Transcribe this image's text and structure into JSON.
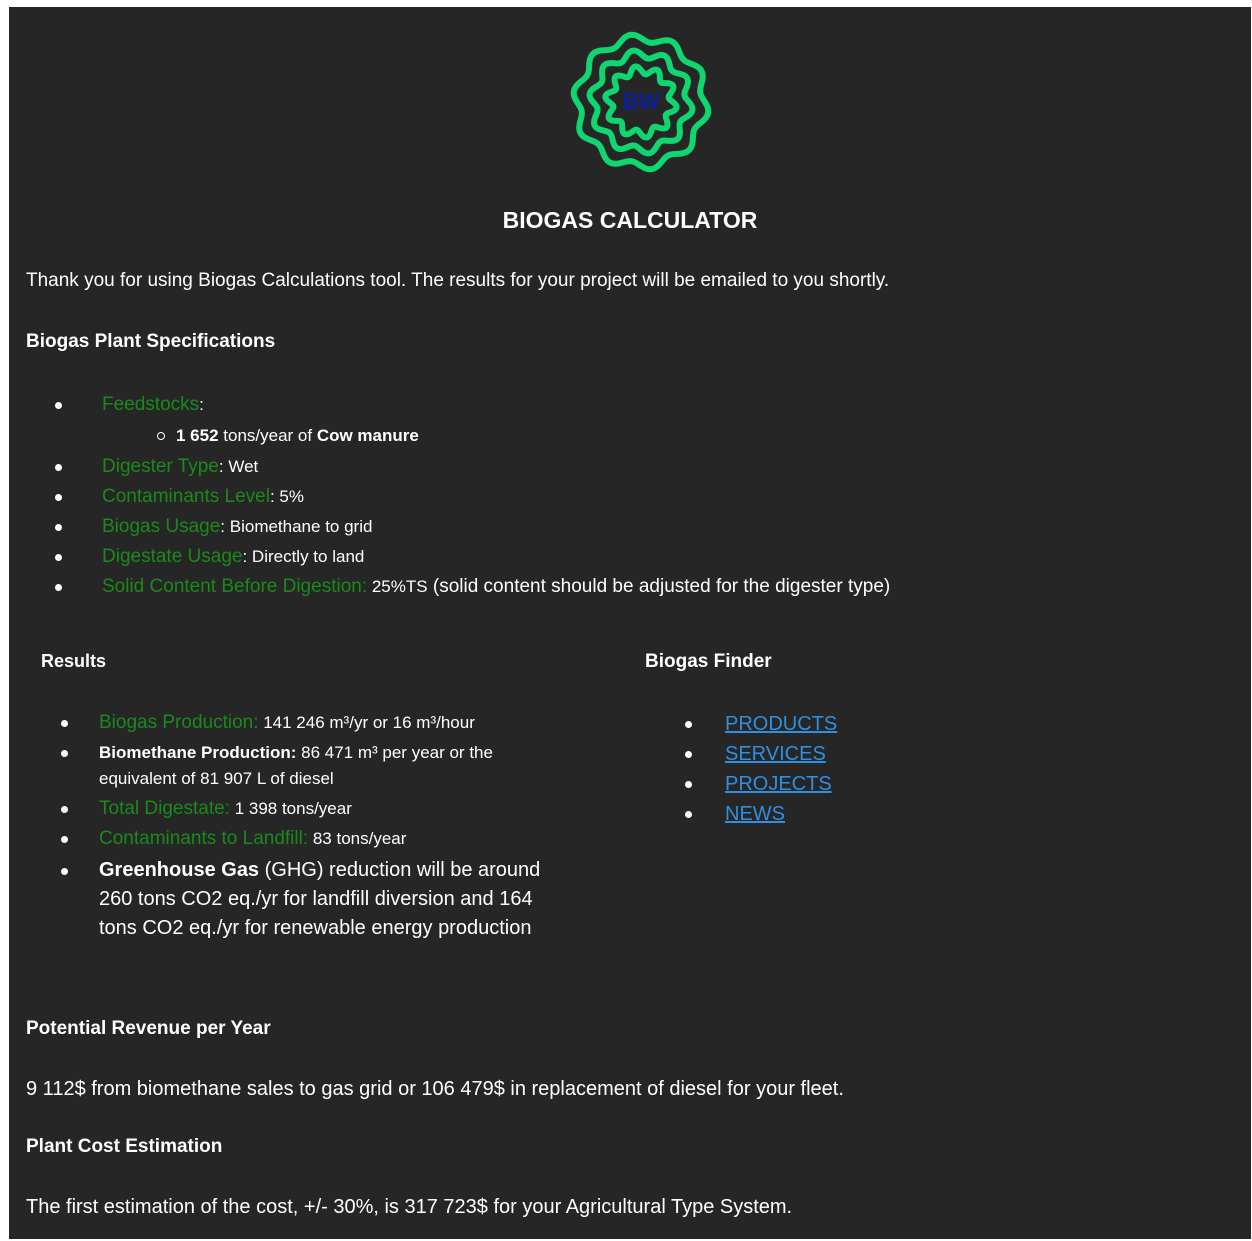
{
  "logo": {
    "text": "BW",
    "color": "#0fd66e"
  },
  "title": "BIOGAS CALCULATOR",
  "intro": "Thank you for using Biogas Calculations tool. The results for your project will be emailed to you shortly.",
  "specs": {
    "heading": "Biogas Plant Specifications",
    "feedstocks_label": "Feedstocks",
    "feedstock_amount": "1 652",
    "feedstock_unit": " tons/year of ",
    "feedstock_name": "Cow manure",
    "digester_label": "Digester Type",
    "digester_value": ": Wet",
    "contaminants_label": "Contaminants Level",
    "contaminants_value": ": 5%",
    "usage_label": "Biogas Usage",
    "usage_value": ": Biomethane to grid",
    "digestate_label": "Digestate Usage",
    "digestate_value": ": Directly to land",
    "solid_label": "Solid Content Before Digestion:",
    "solid_value": " 25%TS",
    "solid_note": " (solid content should be adjusted for the digester type)"
  },
  "results": {
    "heading": "Results",
    "production_label": "Biogas Production:",
    "production_value": " 141 246 m³/yr or 16 m³/hour",
    "biomethane_label": "Biomethane Production:",
    "biomethane_value_1": " 86 471 m³ per year or the",
    "biomethane_value_2": "equivalent of 81 907 L of diesel",
    "digestate_label": "Total Digestate:",
    "digestate_value": " 1 398 tons/year",
    "landfill_label": "Contaminants to Landfill:",
    "landfill_value": " 83 tons/year",
    "ghg_label": "Greenhouse Gas",
    "ghg_line_1": " (GHG) reduction will be around",
    "ghg_line_2": "260 tons CO2 eq./yr for landfill diversion and 164",
    "ghg_line_3": "tons CO2 eq./yr for renewable energy production"
  },
  "finder": {
    "heading": "Biogas Finder",
    "links": [
      "PRODUCTS",
      "SERVICES",
      "PROJECTS",
      "NEWS"
    ]
  },
  "revenue": {
    "heading": "Potential Revenue per Year",
    "text": "9 112$ from biomethane sales to gas grid or 106 479$ in replacement of diesel for your fleet."
  },
  "cost": {
    "heading": "Plant Cost Estimation",
    "text": "The first estimation of the cost, +/- 30%, is 317 723$ for your Agricultural Type System."
  },
  "colors": {
    "background": "#262626",
    "label_green": "#1a8a1a",
    "link": "#2f8fe0"
  }
}
